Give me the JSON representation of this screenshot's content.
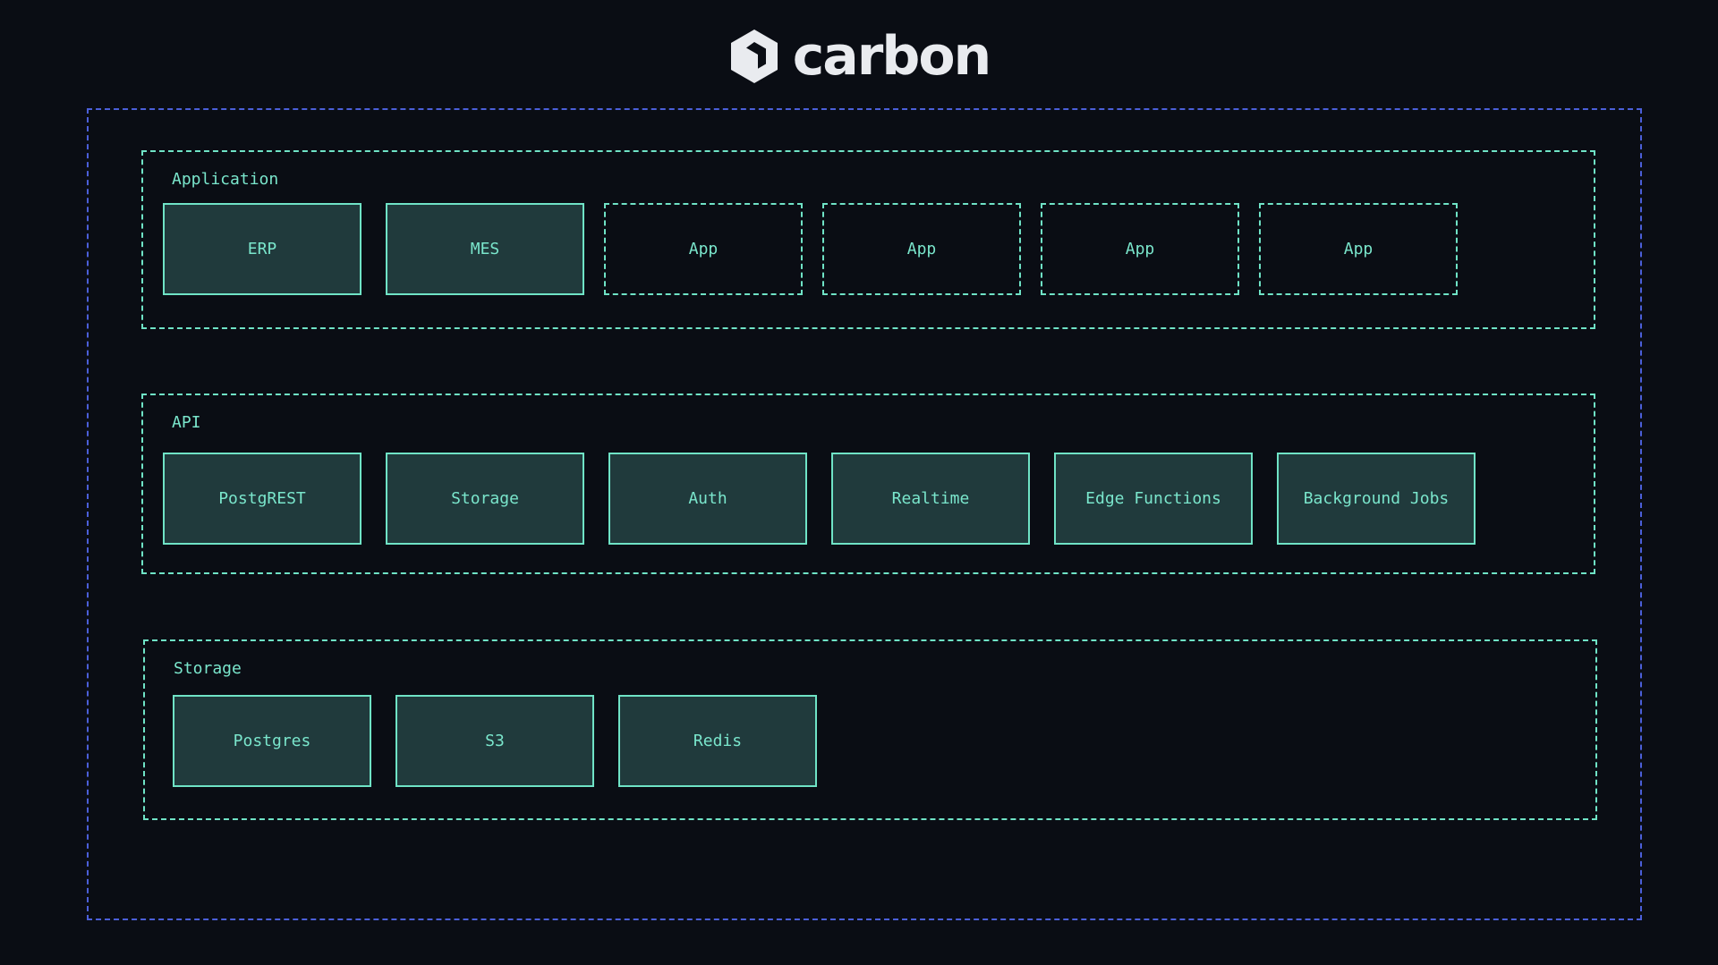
{
  "logo": {
    "text": "carbon",
    "icon": "carbon-hexagon-logo-icon"
  },
  "colors": {
    "background": "#0a0d14",
    "outer_border": "#4b5fd9",
    "layer_border": "#6fe3c6",
    "box_fill": "#203a3c",
    "text": "#7ae6cc",
    "logo": "#e9ebef"
  },
  "layers": {
    "application": {
      "label": "Application",
      "boxes": [
        "ERP",
        "MES",
        "App",
        "App",
        "App",
        "App"
      ]
    },
    "api": {
      "label": "API",
      "boxes": [
        "PostgREST",
        "Storage",
        "Auth",
        "Realtime",
        "Edge Functions",
        "Background Jobs"
      ]
    },
    "storage": {
      "label": "Storage",
      "boxes": [
        "Postgres",
        "S3",
        "Redis"
      ]
    }
  }
}
